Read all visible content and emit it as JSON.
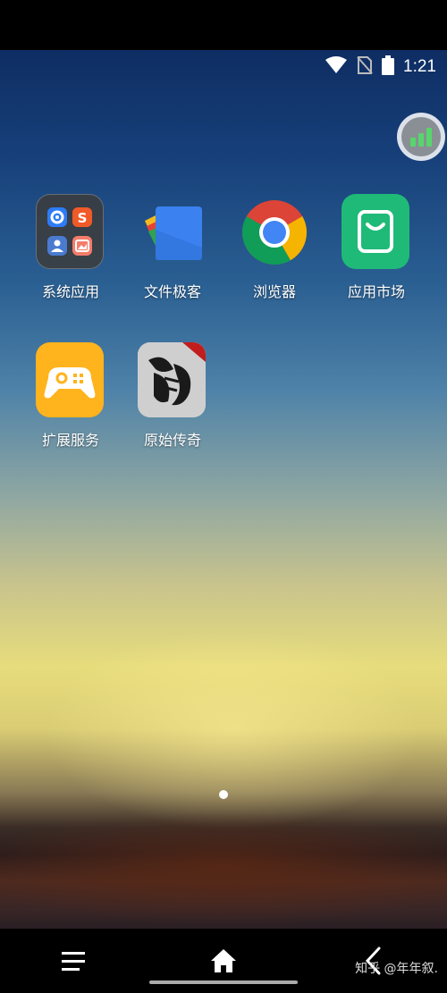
{
  "status_bar": {
    "time": "1:21",
    "icons": [
      "wifi-icon",
      "no-sim-icon",
      "battery-icon"
    ]
  },
  "floating_widget": {
    "icon": "signal-bars-icon",
    "accent": "#57d66c"
  },
  "apps": [
    {
      "label": "系统应用",
      "icon": "system-apps-folder-icon"
    },
    {
      "label": "文件极客",
      "icon": "files-icon"
    },
    {
      "label": "浏览器",
      "icon": "chrome-browser-icon"
    },
    {
      "label": "应用市场",
      "icon": "app-market-icon"
    },
    {
      "label": "扩展服务",
      "icon": "gamepad-icon"
    },
    {
      "label": "原始传奇",
      "icon": "dragon-game-icon"
    }
  ],
  "page_indicator": {
    "current": 1,
    "total": 1
  },
  "nav_bar": {
    "buttons": [
      "menu-icon",
      "home-icon",
      "back-icon"
    ]
  },
  "watermark": "知乎 @年年叙.",
  "colors": {
    "market_green": "#1fba78",
    "extension_yellow": "#ffb31c",
    "files_blue": "#3b82f0"
  }
}
